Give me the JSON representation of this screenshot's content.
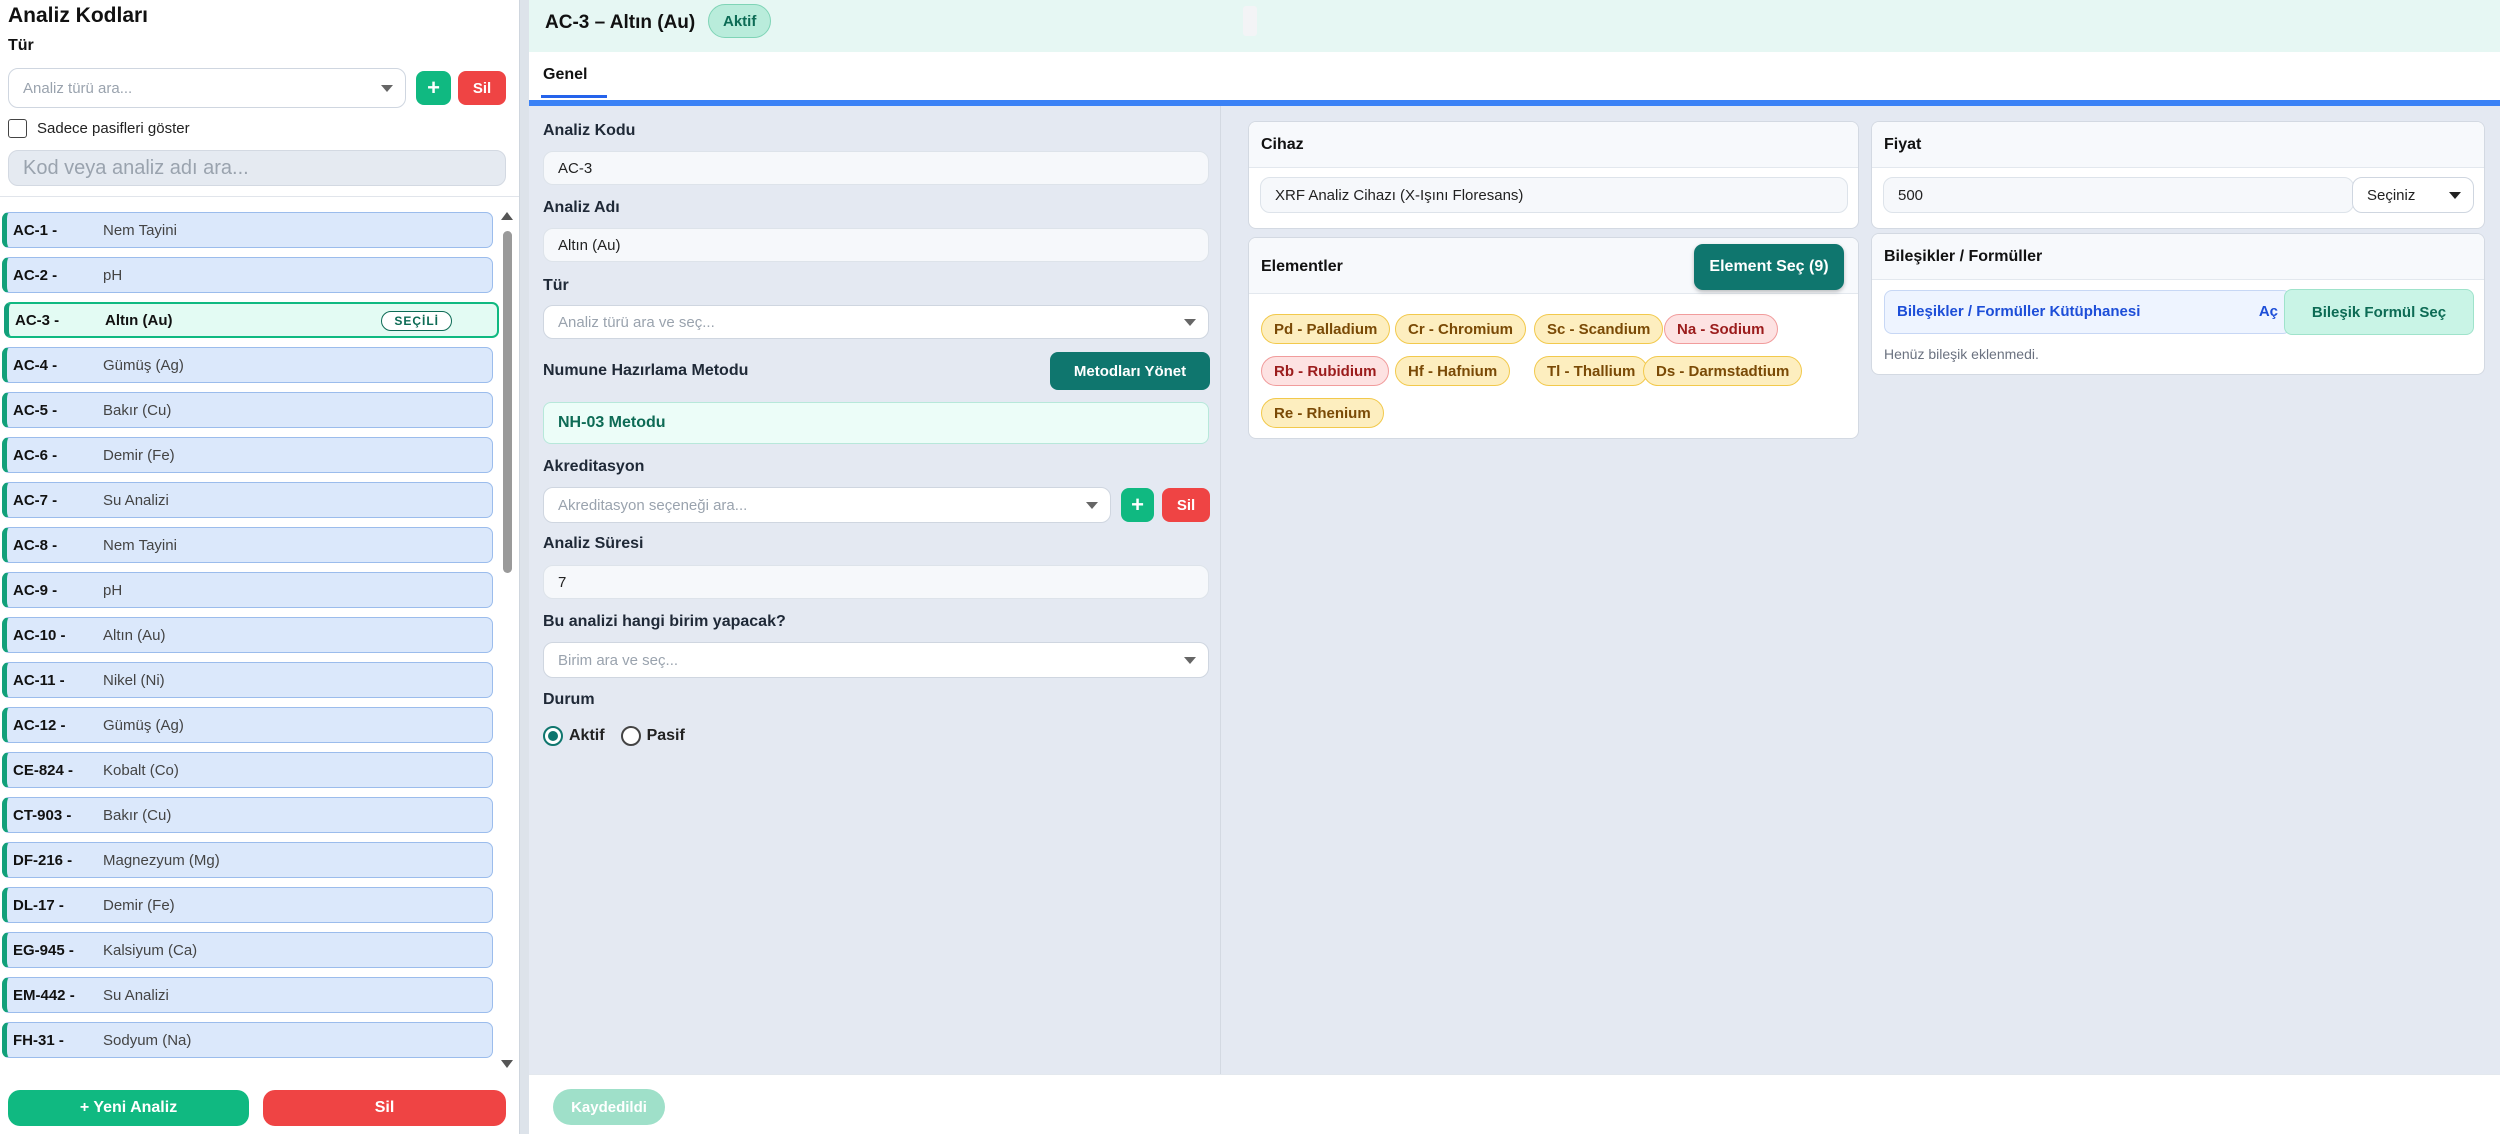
{
  "sidebar": {
    "title": "Analiz Kodları",
    "type_label": "Tür",
    "type_placeholder": "Analiz türü ara...",
    "add_label": "+",
    "delete_label": "Sil",
    "show_passive_label": "Sadece pasifleri göster",
    "search_placeholder": "Kod veya analiz adı ara...",
    "items": [
      {
        "code": "AC-1 -",
        "name": "Nem Tayini"
      },
      {
        "code": "AC-2 -",
        "name": "pH"
      },
      {
        "code": "AC-3 -",
        "name": "Altın (Au)",
        "badge": "SEÇİLİ",
        "selected": true
      },
      {
        "code": "AC-4 -",
        "name": "Gümüş (Ag)"
      },
      {
        "code": "AC-5 -",
        "name": "Bakır (Cu)"
      },
      {
        "code": "AC-6 -",
        "name": "Demir (Fe)"
      },
      {
        "code": "AC-7 -",
        "name": "Su Analizi"
      },
      {
        "code": "AC-8 -",
        "name": "Nem Tayini"
      },
      {
        "code": "AC-9 -",
        "name": "pH"
      },
      {
        "code": "AC-10 -",
        "name": "Altın (Au)"
      },
      {
        "code": "AC-11 -",
        "name": "Nikel (Ni)"
      },
      {
        "code": "AC-12 -",
        "name": "Gümüş (Ag)"
      },
      {
        "code": "CE-824 -",
        "name": "Kobalt (Co)"
      },
      {
        "code": "CT-903 -",
        "name": "Bakır (Cu)"
      },
      {
        "code": "DF-216 -",
        "name": "Magnezyum (Mg)"
      },
      {
        "code": "DL-17 -",
        "name": "Demir (Fe)"
      },
      {
        "code": "EG-945 -",
        "name": "Kalsiyum (Ca)"
      },
      {
        "code": "EM-442 -",
        "name": "Su Analizi"
      },
      {
        "code": "FH-31 -",
        "name": "Sodyum (Na)"
      }
    ],
    "new_button": "+ Yeni Analiz",
    "delete_button": "Sil"
  },
  "header": {
    "title": "AC-3 – Altın (Au)",
    "status": "Aktif"
  },
  "tabs": [
    "Genel"
  ],
  "form": {
    "code_label": "Analiz Kodu",
    "code_value": "AC-3",
    "name_label": "Analiz Adı",
    "name_value": "Altın (Au)",
    "type_label": "Tür",
    "type_placeholder": "Analiz türü ara ve seç...",
    "prep_label": "Numune Hazırlama Metodu",
    "prep_button": "Metodları Yönet",
    "prep_value": "NH-03 Metodu",
    "accr_label": "Akreditasyon",
    "accr_placeholder": "Akreditasyon seçeneği ara...",
    "accr_add": "+",
    "accr_delete": "Sil",
    "duration_label": "Analiz Süresi",
    "duration_value": "7",
    "unit_label": "Bu analizi hangi birim yapacak?",
    "unit_placeholder": "Birim ara ve seç...",
    "status_label": "Durum",
    "status_options": [
      "Aktif",
      "Pasif"
    ],
    "status_selected": "Aktif"
  },
  "device": {
    "title": "Cihaz",
    "value": "XRF Analiz Cihazı (X-Işını Floresans)"
  },
  "price": {
    "title": "Fiyat",
    "value": "500",
    "currency_placeholder": "Seçiniz"
  },
  "elements": {
    "title": "Elementler",
    "button": "Element Seç (9)",
    "tags": [
      {
        "label": "Pd - Palladium",
        "color": "yellow"
      },
      {
        "label": "Cr - Chromium",
        "color": "yellow"
      },
      {
        "label": "Sc - Scandium",
        "color": "yellow"
      },
      {
        "label": "Na - Sodium",
        "color": "red"
      },
      {
        "label": "Rb - Rubidium",
        "color": "red"
      },
      {
        "label": "Hf - Hafnium",
        "color": "yellow"
      },
      {
        "label": "Tl - Thallium",
        "color": "yellow"
      },
      {
        "label": "Ds - Darmstadtium",
        "color": "yellow"
      },
      {
        "label": "Re - Rhenium",
        "color": "yellow"
      }
    ]
  },
  "compounds": {
    "title": "Bileşikler / Formüller",
    "library_label": "Bileşikler / Formüller Kütüphanesi",
    "open_label": "Aç",
    "select_button": "Bileşik Formül Seç",
    "empty_text": "Henüz bileşik eklenmedi."
  },
  "footer": {
    "save_button": "Kaydedildi"
  },
  "colors": {
    "accent": "#10b981",
    "danger": "#ef4444",
    "primary": "#2563eb",
    "teal": "#0f766e"
  }
}
